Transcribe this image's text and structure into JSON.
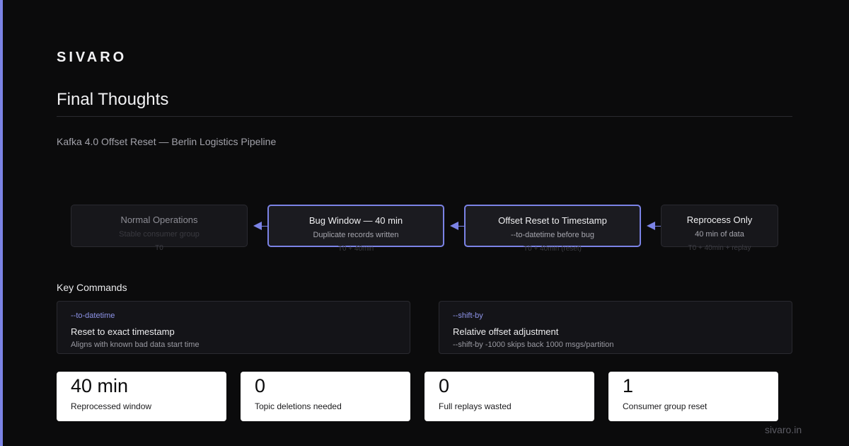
{
  "brand": "SIVARO",
  "title": "Final Thoughts",
  "subtitle": "Kafka 4.0 Offset Reset — Berlin Logistics Pipeline",
  "flow": [
    {
      "title": "Normal Operations",
      "sub": "Stable consumer group",
      "time": "T0"
    },
    {
      "title": "Bug Window — 40 min",
      "sub": "Duplicate records written",
      "time": "T0 + 40min"
    },
    {
      "title": "Offset Reset to Timestamp",
      "sub": "--to-datetime before bug",
      "time": "T0 + 40min (reset)"
    },
    {
      "title": "Reprocess Only",
      "sub": "40 min of data",
      "time": "T0 + 40min + replay"
    }
  ],
  "key_commands": {
    "label": "Key Commands",
    "items": [
      {
        "flag": "--to-datetime",
        "title": "Reset to exact timestamp",
        "desc": "Aligns with known bad data start time"
      },
      {
        "flag": "--shift-by",
        "title": "Relative offset adjustment",
        "desc": "--shift-by -1000 skips back 1000 msgs/partition"
      }
    ]
  },
  "stats": [
    {
      "value": "40 min",
      "label": "Reprocessed window"
    },
    {
      "value": "0",
      "label": "Topic deletions needed"
    },
    {
      "value": "0",
      "label": "Full replays wasted"
    },
    {
      "value": "1",
      "label": "Consumer group reset"
    }
  ],
  "footer_url": "sivaro.in",
  "colors": {
    "accent": "#7b83e6",
    "background": "#0b0b0c",
    "card": "#ffffff"
  }
}
